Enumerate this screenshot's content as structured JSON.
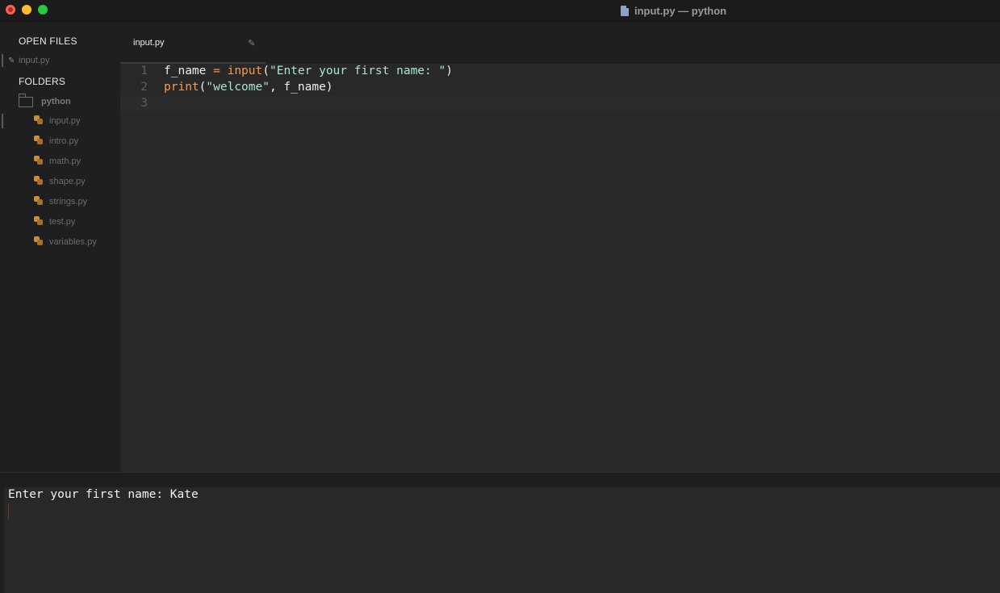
{
  "window": {
    "title": "input.py — python"
  },
  "sidebar": {
    "open_files_heading": "OPEN FILES",
    "open_files": [
      {
        "label": "input.py"
      }
    ],
    "folders_heading": "FOLDERS",
    "folder": {
      "label": "python",
      "files": [
        {
          "label": "input.py"
        },
        {
          "label": "intro.py"
        },
        {
          "label": "math.py"
        },
        {
          "label": "shape.py"
        },
        {
          "label": "strings.py"
        },
        {
          "label": "test.py"
        },
        {
          "label": "variables.py"
        }
      ]
    }
  },
  "tabs": [
    {
      "label": "input.py"
    }
  ],
  "editor": {
    "line_numbers": [
      "1",
      "2",
      "3"
    ],
    "line1": {
      "var": "f_name",
      "op": "=",
      "fn": "input",
      "open": "(",
      "str": "\"Enter your first name: \"",
      "close": ")"
    },
    "line2": {
      "fn": "print",
      "open": "(",
      "str": "\"welcome\"",
      "rest": ", f_name)"
    }
  },
  "console": {
    "output": "Enter your first name: Kate"
  },
  "colors": {
    "keyword_op": "#fd8e4a",
    "function": "#f69c52",
    "string": "#a9e3d4",
    "background": "#282828"
  }
}
